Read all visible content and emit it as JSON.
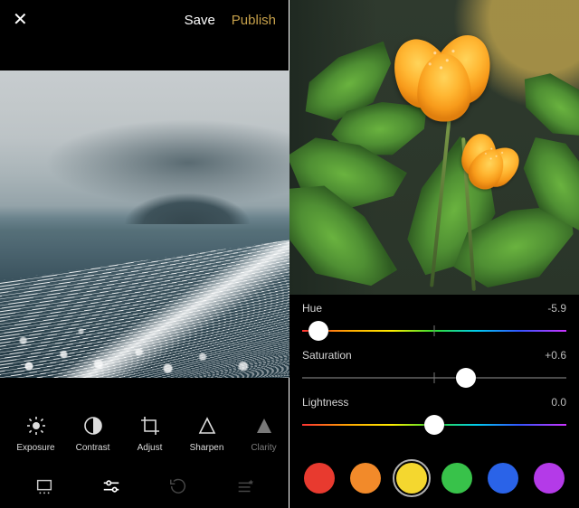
{
  "left": {
    "header": {
      "save": "Save",
      "publish": "Publish"
    },
    "tools": [
      {
        "label": "Exposure"
      },
      {
        "label": "Contrast"
      },
      {
        "label": "Adjust"
      },
      {
        "label": "Sharpen"
      },
      {
        "label": "Clarity"
      }
    ]
  },
  "right": {
    "sliders": {
      "hue": {
        "name": "Hue",
        "value": "-5.9",
        "pos_pct": 6
      },
      "saturation": {
        "name": "Saturation",
        "value": "+0.6",
        "pos_pct": 62
      },
      "lightness": {
        "name": "Lightness",
        "value": "0.0",
        "pos_pct": 50
      }
    },
    "swatches": [
      {
        "color": "#e83a2f",
        "selected": false
      },
      {
        "color": "#f28a2a",
        "selected": false
      },
      {
        "color": "#f4d72f",
        "selected": true
      },
      {
        "color": "#38c24a",
        "selected": false
      },
      {
        "color": "#2a63e8",
        "selected": false
      },
      {
        "color": "#b43ae8",
        "selected": false
      }
    ]
  }
}
